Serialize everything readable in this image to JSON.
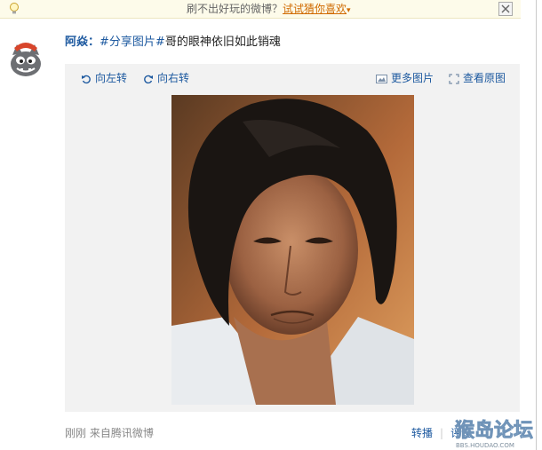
{
  "notice": {
    "message": "刷不出好玩的微博？",
    "link": "试试猜你喜欢"
  },
  "post": {
    "author": "阿焱",
    "colon": "：",
    "topic": "#分享图片#",
    "text": "哥的眼神依旧如此销魂"
  },
  "image_tools": {
    "rotate_left": "向左转",
    "rotate_right": "向右转",
    "more_images": "更多图片",
    "view_original": "查看原图"
  },
  "footer": {
    "time": "刚刚",
    "source": "来自腾讯微博",
    "repost": "转播",
    "comment": "评论"
  },
  "watermark": {
    "title": "猴岛论坛",
    "url": "BBS.HOUDAO.COM"
  },
  "colors": {
    "link": "#1e5aa0",
    "notice_link": "#d06a00",
    "panel_bg": "#f2f2f2"
  }
}
